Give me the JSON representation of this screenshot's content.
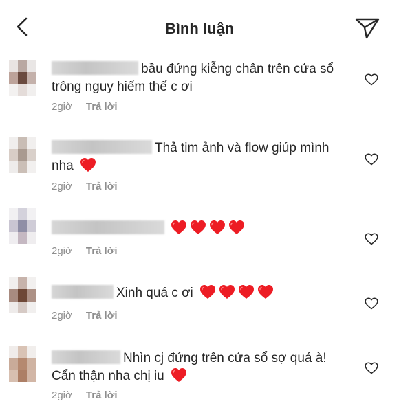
{
  "header": {
    "title": "Bình luận",
    "back_icon": "chevron-left-icon",
    "send_icon": "paper-plane-icon"
  },
  "colors": {
    "heart_red": "#ed1c24",
    "meta_gray": "#8e8e8e",
    "divider": "#dbdbdb"
  },
  "comments": [
    {
      "text_before": "bầu đứng kiễng chân trên cửa sổ trông nguy hiểm thế c ơi",
      "hearts": 0,
      "time": "2giờ",
      "reply_label": "Trả lời"
    },
    {
      "text_before": "Thả tim ảnh và flow giúp mình nha",
      "hearts": 1,
      "time": "2giờ",
      "reply_label": "Trả lời"
    },
    {
      "text_before": "",
      "hearts": 4,
      "time": "2giờ",
      "reply_label": "Trả lời"
    },
    {
      "text_before": "Xinh quá c ơi",
      "hearts": 4,
      "time": "2giờ",
      "reply_label": "Trả lời"
    },
    {
      "text_before": "Nhìn cj đứng trên cửa sổ sợ quá à! Cẩn thận nha chị iu",
      "hearts": 1,
      "time": "2giờ",
      "reply_label": "Trả lời"
    }
  ]
}
